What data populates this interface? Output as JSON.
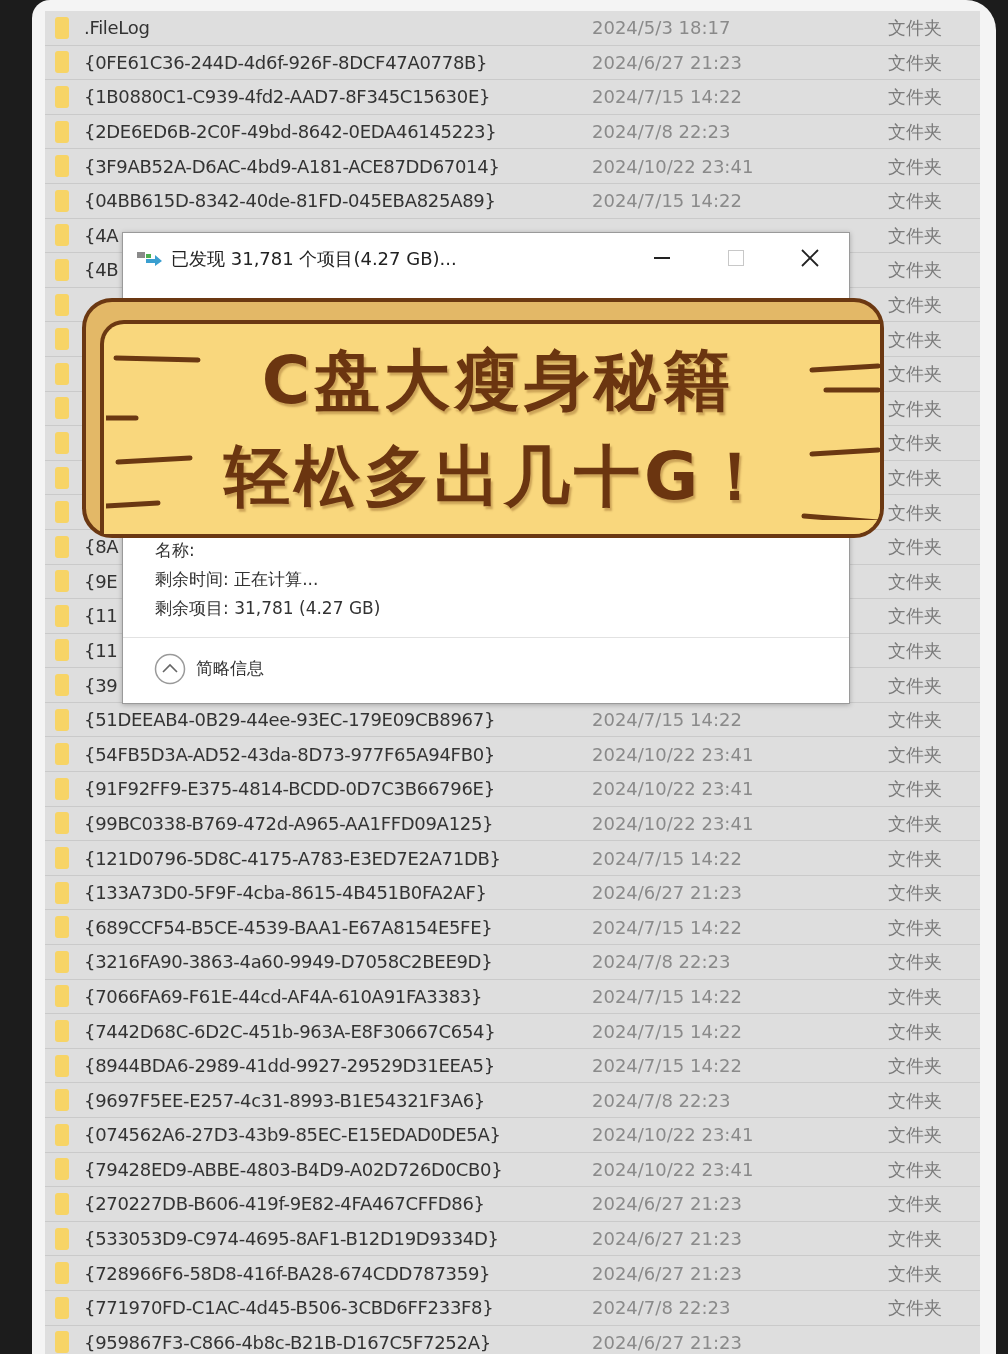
{
  "file_list": {
    "rows": [
      {
        "name": ".FileLog",
        "date": "2024/5/3 18:17",
        "type": "文件夹"
      },
      {
        "name": "{0FE61C36-244D-4d6f-926F-8DCF47A0778B}",
        "date": "2024/6/27 21:23",
        "type": "文件夹"
      },
      {
        "name": "{1B0880C1-C939-4fd2-AAD7-8F345C15630E}",
        "date": "2024/7/15 14:22",
        "type": "文件夹"
      },
      {
        "name": "{2DE6ED6B-2C0F-49bd-8642-0EDA46145223}",
        "date": "2024/7/8 22:23",
        "type": "文件夹"
      },
      {
        "name": "{3F9AB52A-D6AC-4bd9-A181-ACE87DD67014}",
        "date": "2024/10/22 23:41",
        "type": "文件夹"
      },
      {
        "name": "{04BB615D-8342-40de-81FD-045EBA825A89}",
        "date": "2024/7/15 14:22",
        "type": "文件夹"
      },
      {
        "name": "{4A",
        "type": "文件夹"
      },
      {
        "name": "{4B",
        "type": "文件夹"
      },
      {
        "type": "文件夹"
      },
      {
        "type": "文件夹"
      },
      {
        "type": "文件夹"
      },
      {
        "type": "文件夹"
      },
      {
        "type": "文件夹"
      },
      {
        "type": "文件夹"
      },
      {
        "type": "文件夹"
      },
      {
        "name": "{8A",
        "type": "文件夹"
      },
      {
        "name": "{9E",
        "type": "文件夹"
      },
      {
        "name": "{11",
        "type": "文件夹"
      },
      {
        "name": "{11",
        "type": "文件夹"
      },
      {
        "name": "{39",
        "type": "文件夹"
      },
      {
        "name": "{51DEEAB4-0B29-44ee-93EC-179E09CB8967}",
        "date": "2024/7/15 14:22",
        "type": "文件夹"
      },
      {
        "name": "{54FB5D3A-AD52-43da-8D73-977F65A94FB0}",
        "date": "2024/10/22 23:41",
        "type": "文件夹"
      },
      {
        "name": "{91F92FF9-E375-4814-BCDD-0D7C3B66796E}",
        "date": "2024/10/22 23:41",
        "type": "文件夹"
      },
      {
        "name": "{99BC0338-B769-472d-A965-AA1FFD09A125}",
        "date": "2024/10/22 23:41",
        "type": "文件夹"
      },
      {
        "name": "{121D0796-5D8C-4175-A783-E3ED7E2A71DB}",
        "date": "2024/7/15 14:22",
        "type": "文件夹"
      },
      {
        "name": "{133A73D0-5F9F-4cba-8615-4B451B0FA2AF}",
        "date": "2024/6/27 21:23",
        "type": "文件夹"
      },
      {
        "name": "{689CCF54-B5CE-4539-BAA1-E67A8154E5FE}",
        "date": "2024/7/15 14:22",
        "type": "文件夹"
      },
      {
        "name": "{3216FA90-3863-4a60-9949-D7058C2BEE9D}",
        "date": "2024/7/8 22:23",
        "type": "文件夹"
      },
      {
        "name": "{7066FA69-F61E-44cd-AF4A-610A91FA3383}",
        "date": "2024/7/15 14:22",
        "type": "文件夹"
      },
      {
        "name": "{7442D68C-6D2C-451b-963A-E8F30667C654}",
        "date": "2024/7/15 14:22",
        "type": "文件夹"
      },
      {
        "name": "{8944BDA6-2989-41dd-9927-29529D31EEA5}",
        "date": "2024/7/15 14:22",
        "type": "文件夹"
      },
      {
        "name": "{9697F5EE-E257-4c31-8993-B1E54321F3A6}",
        "date": "2024/7/8 22:23",
        "type": "文件夹"
      },
      {
        "name": "{074562A6-27D3-43b9-85EC-E15EDAD0DE5A}",
        "date": "2024/10/22 23:41",
        "type": "文件夹"
      },
      {
        "name": "{79428ED9-ABBE-4803-B4D9-A02D726D0CB0}",
        "date": "2024/10/22 23:41",
        "type": "文件夹"
      },
      {
        "name": "{270227DB-B606-419f-9E82-4FA467CFFD86}",
        "date": "2024/6/27 21:23",
        "type": "文件夹"
      },
      {
        "name": "{533053D9-C974-4695-8AF1-B12D19D9334D}",
        "date": "2024/6/27 21:23",
        "type": "文件夹"
      },
      {
        "name": "{728966F6-58D8-416f-BA28-674CDD787359}",
        "date": "2024/6/27 21:23",
        "type": "文件夹"
      },
      {
        "name": "{771970FD-C1AC-4d45-B506-3CBD6FF233F8}",
        "date": "2024/7/8 22:23",
        "type": "文件夹"
      },
      {
        "name": "{959867F3-C866-4b8c-B21B-D167C5F7252A}",
        "date": "2024/6/27 21:23"
      }
    ]
  },
  "dialog": {
    "title": "已发现 31,781 个项目(4.27 GB)...",
    "maximize_disabled": true,
    "details": [
      "名称:",
      "剩余时间: 正在计算...",
      "剩余项目: 31,781 (4.27 GB)"
    ],
    "toggle": {
      "label": "简略信息",
      "expanded": true
    }
  },
  "banner": {
    "lines": [
      "C盘大瘦身秘籍",
      "轻松多出几十G！"
    ]
  }
}
